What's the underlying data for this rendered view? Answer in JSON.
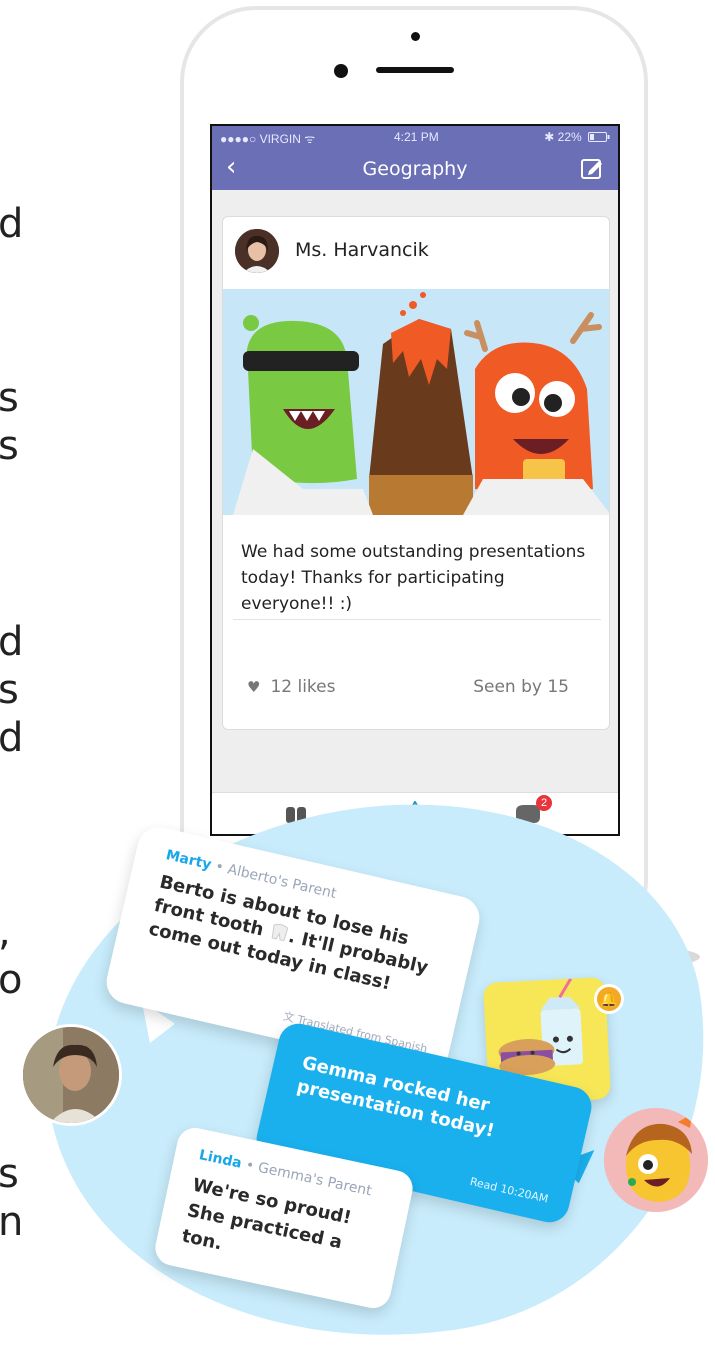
{
  "left_edge_fragments": [
    "d",
    "s",
    "s",
    "d",
    "s",
    "d",
    ",",
    "o",
    "s",
    "n"
  ],
  "status_bar": {
    "carrier": "●●●●○ VIRGIN ᯤ",
    "time": "4:21 PM",
    "battery": "✱ 22%"
  },
  "navbar": {
    "back_symbol": "‹",
    "title": "Geography"
  },
  "post": {
    "author": "Ms. Harvancik",
    "body": "We had some outstanding presentations today! Thanks for participating everyone!! :)",
    "likes": "12 likes",
    "seen": "Seen by 15"
  },
  "tabbar": {
    "messages_badge": "2"
  },
  "chat": {
    "message1": {
      "sender": "Marty",
      "relation": " • Alberto's Parent",
      "text_part1": "Berto is about to lose his front tooth ",
      "text_part2": ". It'll probably come out today in class!",
      "translated": "Translated from Spanish"
    },
    "message2": {
      "text": "Gemma rocked her presentation today!",
      "read": "Read 10:20AM"
    },
    "message3": {
      "sender": "Linda",
      "relation": " • Gemma's Parent",
      "text": "We're so proud! She practiced a ton."
    }
  },
  "colors": {
    "brand_purple": "#6a6fb6",
    "chat_blue": "#1ab0ee",
    "blob": "#c8ecfb",
    "sticker_yellow": "#f7e655",
    "notification_orange": "#f4a823",
    "badge_red": "#e8343c"
  }
}
